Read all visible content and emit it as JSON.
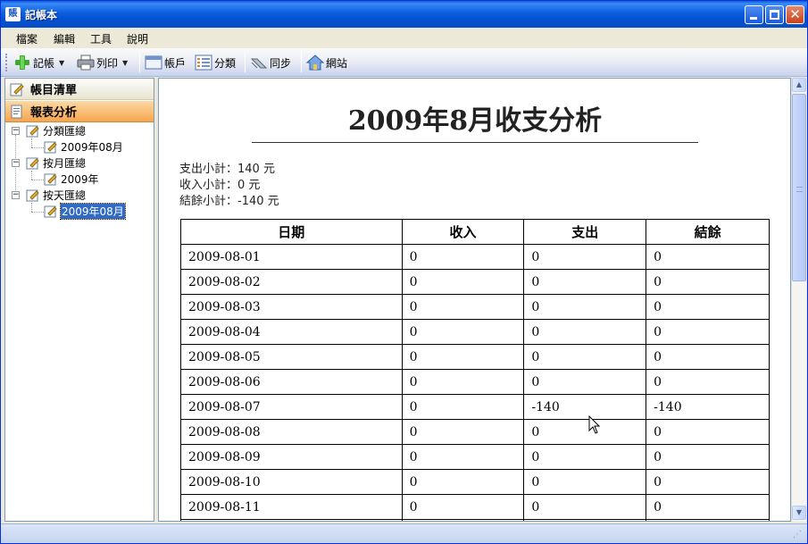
{
  "window": {
    "app_icon_text": "賬",
    "title": "記帳本"
  },
  "menu": {
    "items": [
      "檔案",
      "編輯",
      "工具",
      "說明"
    ]
  },
  "toolbar": {
    "record": "記帳",
    "print": "列印",
    "accounts": "帳戶",
    "categories": "分類",
    "sync": "同步",
    "website": "網站"
  },
  "nav": {
    "ledger": "帳目清單",
    "reports": "報表分析"
  },
  "tree": {
    "by_category": "分類匯總",
    "by_category_child": "2009年08月",
    "by_month": "按月匯總",
    "by_month_child": "2009年",
    "by_day": "按天匯總",
    "by_day_child": "2009年08月"
  },
  "report": {
    "title": "2009年8月收支分析",
    "expense_subtotal": "支出小計：140 元",
    "income_subtotal": "收入小計：0 元",
    "balance_subtotal": "結餘小計：-140 元",
    "columns": [
      "日期",
      "收入",
      "支出",
      "結餘"
    ],
    "rows": [
      [
        "2009-08-01",
        "0",
        "0",
        "0"
      ],
      [
        "2009-08-02",
        "0",
        "0",
        "0"
      ],
      [
        "2009-08-03",
        "0",
        "0",
        "0"
      ],
      [
        "2009-08-04",
        "0",
        "0",
        "0"
      ],
      [
        "2009-08-05",
        "0",
        "0",
        "0"
      ],
      [
        "2009-08-06",
        "0",
        "0",
        "0"
      ],
      [
        "2009-08-07",
        "0",
        "-140",
        "-140"
      ],
      [
        "2009-08-08",
        "0",
        "0",
        "0"
      ],
      [
        "2009-08-09",
        "0",
        "0",
        "0"
      ],
      [
        "2009-08-10",
        "0",
        "0",
        "0"
      ],
      [
        "2009-08-11",
        "0",
        "0",
        "0"
      ],
      [
        "",
        "",
        "",
        ""
      ]
    ]
  },
  "colors": {
    "titlebar": "#0a5fd8",
    "active_nav": "#f6a54e",
    "selection": "#316ac5"
  }
}
